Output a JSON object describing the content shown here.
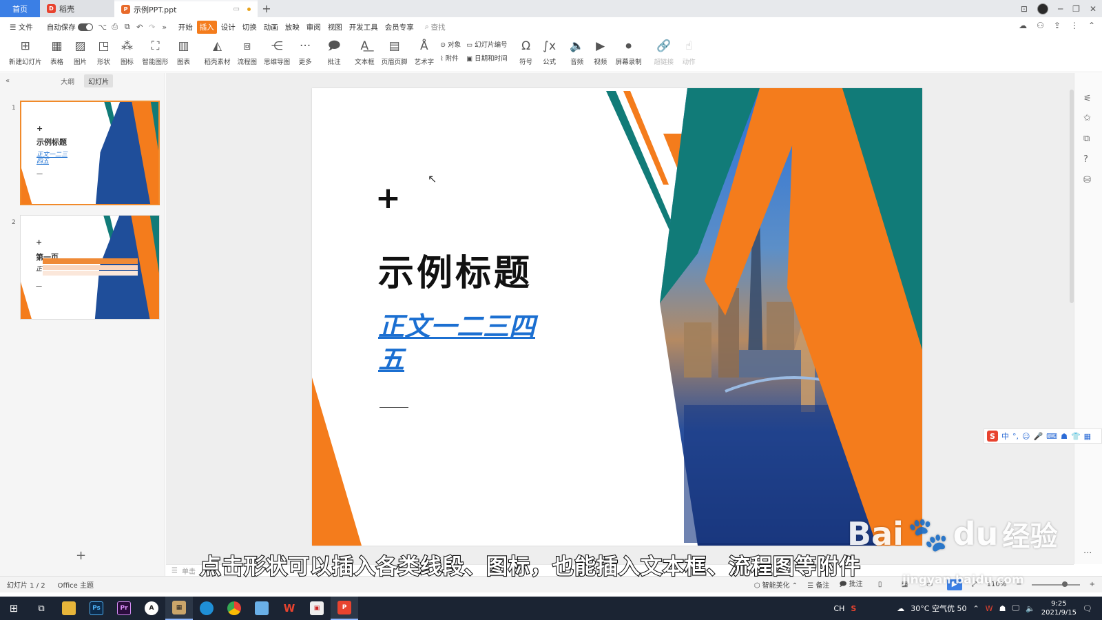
{
  "tabs": [
    {
      "label": "首页"
    },
    {
      "label": "稻壳"
    },
    {
      "label": "示例PPT.ppt"
    }
  ],
  "menu": {
    "file": "文件",
    "autosave": "自动保存",
    "items": [
      "开始",
      "插入",
      "设计",
      "切换",
      "动画",
      "放映",
      "审阅",
      "视图",
      "开发工具",
      "会员专享"
    ],
    "active_index": 1,
    "search_label": "查找"
  },
  "ribbon": {
    "new_slide": "新建幻灯片",
    "table": "表格",
    "picture": "图片",
    "shape": "形状",
    "icon": "图标",
    "smart_graphic": "智能图形",
    "chart": "图表",
    "docer_material": "稻壳素材",
    "flowchart": "流程图",
    "mindmap": "思维导图",
    "more": "更多",
    "comment": "批注",
    "textbox": "文本框",
    "header_footer": "页眉页脚",
    "wordart": "艺术字",
    "object": "对象",
    "attachment": "附件",
    "slide_number": "幻灯片编号",
    "datetime": "日期和时间",
    "symbol": "符号",
    "formula": "公式",
    "audio": "音频",
    "video": "视频",
    "screen_record": "屏幕录制",
    "hyperlink": "超链接",
    "action": "动作"
  },
  "left_panel": {
    "tab_outline": "大纲",
    "tab_slides": "幻灯片",
    "slides": [
      {
        "num": "1",
        "plus": "+",
        "title": "示例标题",
        "body": "正文一二三四五",
        "dash": "一"
      },
      {
        "num": "2",
        "plus": "+",
        "title": "第一页",
        "body": "正",
        "dash": "一"
      }
    ]
  },
  "slide": {
    "plus": "+",
    "title": "示例标题",
    "body": "正文一二三四五"
  },
  "notes_placeholder": "单击",
  "ime": {
    "logo": "S",
    "lang": "中"
  },
  "subtitle": "点击形状可以插入各类线段、图标，也能插入文本框、流程图等附件",
  "watermark": {
    "brand": "Bai",
    "brand2": "du",
    "suffix": "经验",
    "url": "jingyan.baidu.com"
  },
  "status": {
    "slide_counter": "幻灯片 1 / 2",
    "theme": "Office 主题",
    "beautify": "智能美化",
    "notes": "备注",
    "comment": "批注",
    "zoom": "110%"
  },
  "taskbar": {
    "lang": "CH",
    "weather": "30°C 空气优 50",
    "time": "9:25",
    "date": "2021/9/15"
  },
  "colors": {
    "accent_orange": "#f47c1c",
    "teal": "#117b78",
    "tab_blue": "#3b7fe5",
    "body_blue": "#1b6fd1"
  }
}
